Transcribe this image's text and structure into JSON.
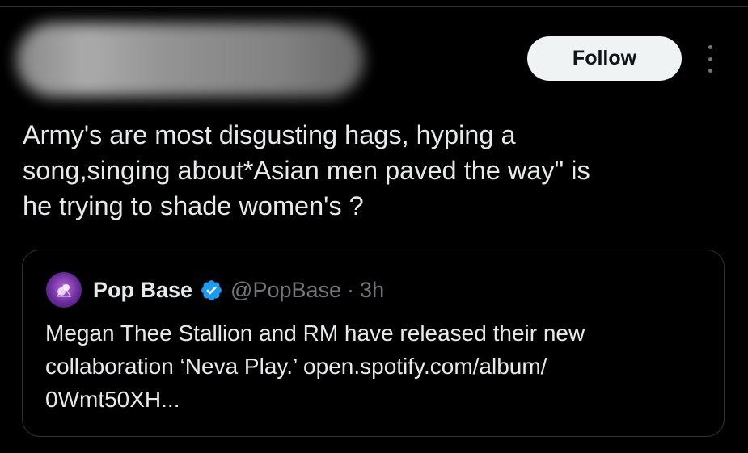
{
  "post": {
    "follow_label": "Follow",
    "more_icon": "more-dots-vertical-icon",
    "text_lines": [
      "Army's are most disgusting hags, hyping a",
      "song,singing about*Asian men paved the way\" is",
      "he trying to shade women's ?"
    ]
  },
  "quote": {
    "author_name": "Pop Base",
    "verified": true,
    "verified_color": "#1d9bf0",
    "handle": "@PopBase",
    "separator": "·",
    "time": "3h",
    "body_lines": [
      "Megan Thee Stallion and RM have released their new",
      "collaboration ‘Neva Play.’ open.spotify.com/album/",
      "0Wmt50XH..."
    ]
  },
  "colors": {
    "background": "#000000",
    "text": "#e7e9ea",
    "muted": "#71767b",
    "border": "#2f3336",
    "button_bg": "#eff3f4"
  }
}
